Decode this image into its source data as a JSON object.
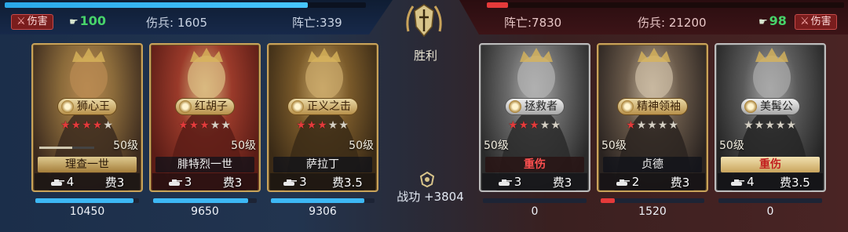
{
  "left": {
    "damage_tag": "伤害",
    "morale": "100",
    "wounded_label": "伤兵: 1605",
    "killed_label": "阵亡:339",
    "hp_fraction": 0.84
  },
  "right": {
    "damage_tag": "伤害",
    "morale": "98",
    "wounded_label": "伤兵: 21200",
    "killed_label": "阵亡:7830",
    "hp_fraction": 0.06
  },
  "center": {
    "result": "胜利",
    "merit": "战功 +3804"
  },
  "heroes": [
    {
      "name": "狮心王",
      "stars": 5,
      "stars_on": 4,
      "level": "50级",
      "tag": "理查一世",
      "tag_style": "gold",
      "troops": "4",
      "cost": "费3",
      "hp": "10450",
      "hp_fraction": 0.95,
      "side": "left",
      "frame": "gold",
      "palette": [
        "#8a6a3a",
        "#3b2a1e",
        "#b88a52"
      ]
    },
    {
      "name": "红胡子",
      "stars": 5,
      "stars_on": 3,
      "level": "50级",
      "tag": "腓特烈一世",
      "tag_style": "dark",
      "troops": "3",
      "cost": "费3",
      "hp": "9650",
      "hp_fraction": 0.92,
      "side": "left",
      "frame": "gold",
      "palette": [
        "#9a3a2a",
        "#5a1c16",
        "#d9b980"
      ]
    },
    {
      "name": "正义之击",
      "stars": 5,
      "stars_on": 3,
      "level": "50级",
      "tag": "萨拉丁",
      "tag_style": "dark",
      "troops": "3",
      "cost": "费3.5",
      "hp": "9306",
      "hp_fraction": 0.9,
      "side": "left",
      "frame": "gold",
      "palette": [
        "#7a5a2a",
        "#3a2a16",
        "#c9a86a"
      ]
    },
    {
      "name": "拯救者",
      "stars": 5,
      "stars_on": 3,
      "level": "50级",
      "tag": "重伤",
      "tag_style": "injured-dark",
      "troops": "3",
      "cost": "费3",
      "hp": "0",
      "hp_fraction": 0,
      "side": "right",
      "frame": "gray",
      "palette": [
        "#6a6a6a",
        "#2a2a2a",
        "#b0b0b0"
      ]
    },
    {
      "name": "精神领袖",
      "stars": 5,
      "stars_on": 1,
      "level": "50级",
      "tag": "贞德",
      "tag_style": "dark",
      "troops": "2",
      "cost": "费3",
      "hp": "1520",
      "hp_fraction": 0.14,
      "side": "right",
      "frame": "gold",
      "palette": [
        "#6a5a4a",
        "#2a2320",
        "#c8b8a0"
      ]
    },
    {
      "name": "美髯公",
      "stars": 5,
      "stars_on": 0,
      "level": "50级",
      "tag": "重伤",
      "tag_style": "injured",
      "troops": "4",
      "cost": "费3.5",
      "hp": "0",
      "hp_fraction": 0,
      "side": "right",
      "frame": "gray",
      "palette": [
        "#5a5a5a",
        "#242424",
        "#a8a8a8"
      ]
    }
  ],
  "colors": {
    "blue_side": "#3db8f5",
    "red_side": "#e53a3a",
    "morale": "#47d36a"
  }
}
